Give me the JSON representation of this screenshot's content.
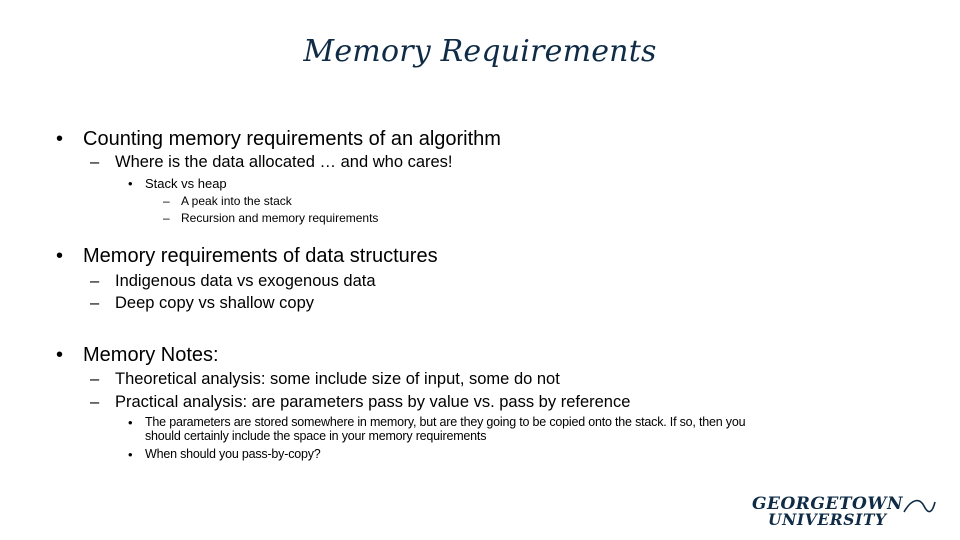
{
  "slide": {
    "title": "Memory Requirements",
    "sections": [
      {
        "text": "Counting memory requirements of an algorithm",
        "children": [
          {
            "text": "Where is the data allocated … and who cares!",
            "children": [
              {
                "text": "Stack vs heap",
                "children": [
                  {
                    "text": "A peak into the stack"
                  },
                  {
                    "text": "Recursion and memory requirements"
                  }
                ]
              }
            ]
          }
        ]
      },
      {
        "text": "Memory requirements of data structures",
        "children": [
          {
            "text": "Indigenous data vs exogenous data"
          },
          {
            "text": "Deep copy vs shallow copy"
          }
        ]
      },
      {
        "text": "Memory Notes:",
        "children": [
          {
            "text": "Theoretical analysis: some include size of input, some do not"
          },
          {
            "text": "Practical analysis: are parameters pass by value vs. pass by reference",
            "children": [
              {
                "text_line1": "The parameters are stored somewhere in memory, but are they going to be copied onto the stack. If so, then you",
                "text_line2": "should certainly include the space in your memory requirements"
              },
              {
                "text": "When should you pass-by-copy?"
              }
            ]
          }
        ]
      }
    ],
    "bullet_glyph": "•",
    "dash_glyph": "–",
    "logo": {
      "line1": "GEORGETOWN",
      "line2": "UNIVERSITY"
    }
  }
}
